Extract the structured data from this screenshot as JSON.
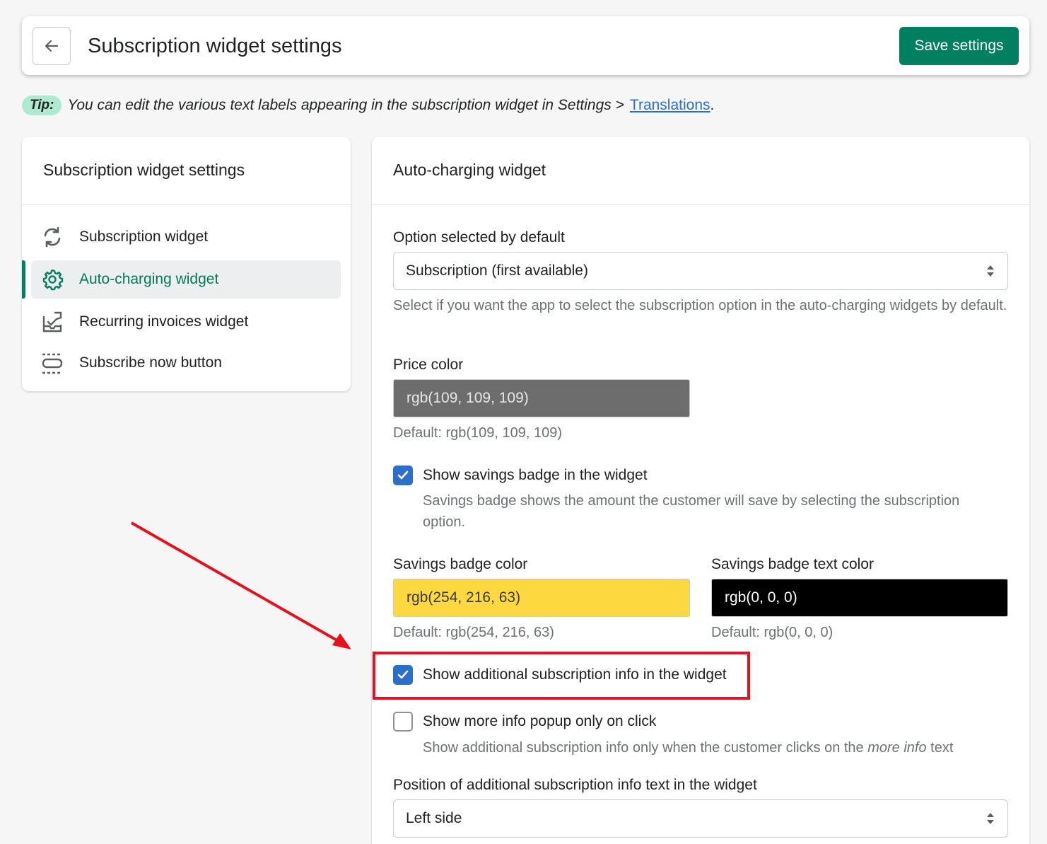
{
  "header": {
    "title": "Subscription widget settings",
    "save_label": "Save settings"
  },
  "tip": {
    "badge": "Tip:",
    "text": "You can edit the various text labels appearing in the subscription widget in Settings >",
    "link": "Translations",
    "suffix": "."
  },
  "sidebar": {
    "title": "Subscription widget settings",
    "items": [
      {
        "label": "Subscription widget",
        "icon": "refresh-icon",
        "active": false
      },
      {
        "label": "Auto-charging widget",
        "icon": "gear-icon",
        "active": true
      },
      {
        "label": "Recurring invoices widget",
        "icon": "invoice-icon",
        "active": false
      },
      {
        "label": "Subscribe now button",
        "icon": "button-icon",
        "active": false
      }
    ]
  },
  "main": {
    "title": "Auto-charging widget",
    "option_default": {
      "label": "Option selected by default",
      "value": "Subscription (first available)",
      "help": "Select if you want the app to select the subscription option in the auto-charging widgets by default."
    },
    "price_color": {
      "label": "Price color",
      "value": "rgb(109, 109, 109)",
      "default": "Default: rgb(109, 109, 109)",
      "swatch": "#6d6d6d"
    },
    "savings_badge": {
      "label": "Show savings badge in the widget",
      "checked": true,
      "help": "Savings badge shows the amount the customer will save by selecting the subscription option."
    },
    "savings_badge_color": {
      "label": "Savings badge color",
      "value": "rgb(254, 216, 63)",
      "default": "Default: rgb(254, 216, 63)",
      "swatch": "#fed83f"
    },
    "savings_badge_text_color": {
      "label": "Savings badge text color",
      "value": "rgb(0, 0, 0)",
      "default": "Default: rgb(0, 0, 0)",
      "swatch": "#000000"
    },
    "additional_info": {
      "label": "Show additional subscription info in the widget",
      "checked": true
    },
    "more_info_popup": {
      "label": "Show more info popup only on click",
      "checked": false,
      "help_prefix": "Show additional subscription info only when the customer clicks on the",
      "help_em": "more info",
      "help_suffix": "text"
    },
    "position": {
      "label": "Position of additional subscription info text in the widget",
      "value": "Left side"
    }
  },
  "colors": {
    "primary": "#008060",
    "checkbox": "#2c6ecb",
    "annotation": "#e8101a"
  }
}
